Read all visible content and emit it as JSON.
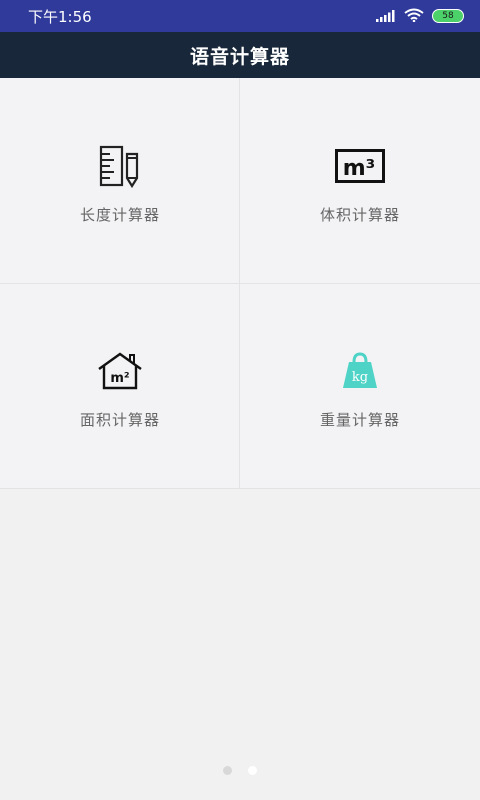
{
  "status_bar": {
    "time": "下午1:56",
    "battery": "58",
    "icons": [
      "signal-icon",
      "wifi-icon",
      "battery-icon"
    ]
  },
  "header": {
    "title": "语音计算器"
  },
  "calculators": [
    {
      "label": "长度计算器",
      "icon": "ruler-pencil-icon"
    },
    {
      "label": "体积计算器",
      "icon": "cubic-meter-icon",
      "icon_text": "m³"
    },
    {
      "label": "面积计算器",
      "icon": "house-area-icon",
      "icon_text": "m²"
    },
    {
      "label": "重量计算器",
      "icon": "kg-weight-icon",
      "icon_text": "kg"
    }
  ],
  "pager": {
    "pages": 2,
    "active_page": 2
  },
  "colors": {
    "status_bar_bg": "#2f3a9a",
    "app_bar_bg": "#18283a",
    "weight_icon": "#4fd3c6",
    "battery": "#4cd06a"
  }
}
